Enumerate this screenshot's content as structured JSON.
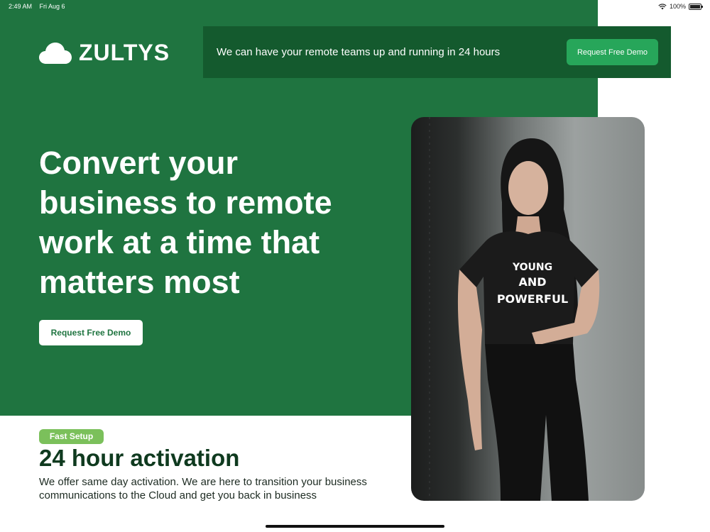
{
  "status_bar": {
    "time": "2:49 AM",
    "date": "Fri Aug 6",
    "battery": "100%",
    "icons": [
      "wifi-icon",
      "battery-icon"
    ]
  },
  "header": {
    "logo_icon": "cloud-icon",
    "logo_text": "ZULTYS",
    "banner_text": "We can have your remote teams up and running in 24 hours",
    "banner_button": "Request Free Demo"
  },
  "hero": {
    "title": "Convert your business to remote work at a time that matters most",
    "button": "Request Free Demo",
    "photo_shirt_lines": [
      "YOUNG",
      "AND",
      "POWERFUL"
    ]
  },
  "section": {
    "badge": "Fast Setup",
    "title": "24 hour activation",
    "body": "We offer same day activation. We are here to transition your business communications to the Cloud and get you back in business"
  },
  "colors": {
    "primary_green": "#1f7440",
    "banner_green": "#145a2e",
    "button_green": "#27a65a",
    "badge_green": "#7bc05b",
    "heading_dark": "#0f3a1f"
  }
}
